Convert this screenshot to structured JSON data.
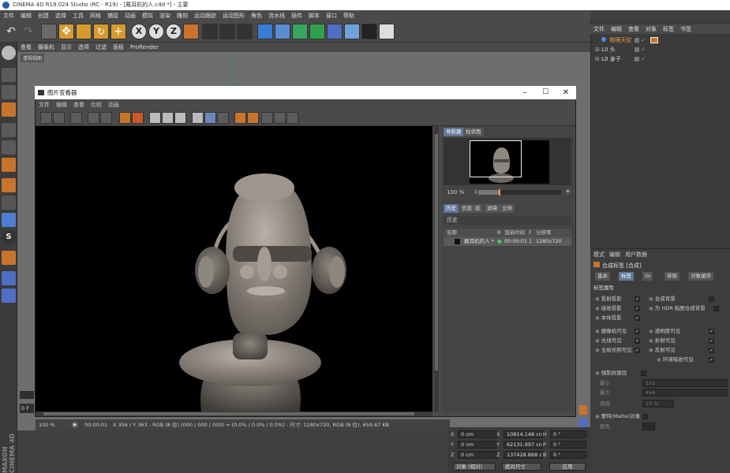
{
  "window": {
    "title": "CINEMA 4D R19.024 Studio (RC - R19) - [戴耳机的人.c4d *] - 主要"
  },
  "menubar": [
    "文件",
    "编辑",
    "创建",
    "选择",
    "工具",
    "网格",
    "捕捉",
    "动画",
    "模拟",
    "渲染",
    "雕刻",
    "运动跟踪",
    "运动图形",
    "角色",
    "流水线",
    "插件",
    "脚本",
    "窗口",
    "帮助"
  ],
  "viewport": {
    "menu": [
      "查看",
      "摄像机",
      "显示",
      "选项",
      "过滤",
      "面板",
      "ProRender"
    ],
    "label": "透视视图"
  },
  "picture_viewer": {
    "title": "图片查看器",
    "menu": [
      "文件",
      "编辑",
      "查看",
      "比较",
      "动画"
    ],
    "side_tabs": [
      "导航器",
      "柱状图"
    ],
    "zoom": "100 %",
    "history_tabs": [
      "历史",
      "信息",
      "层",
      "滤镜",
      "立体"
    ],
    "history_label": "历史",
    "table_headers": [
      "名称",
      "R",
      "渲染时间",
      "F",
      "分辨率"
    ],
    "table_row": {
      "name": "戴耳机的人 *",
      "r": "●",
      "time": "00:00:01",
      "f": "1",
      "res": "1280x720"
    },
    "status": {
      "zoom": "100 %",
      "time": "00:00:01",
      "info": "X 356 / Y 363 - RGB (8 位) (000 / 000 / 000) = (0.0% / 0.0% / 0.0%) - 尺寸: 1280x720, RGB (8 位), 659.67 KB"
    }
  },
  "right_tabs": [
    "文件",
    "编辑",
    "查看",
    "对象",
    "标签",
    "书签"
  ],
  "objects": [
    {
      "name": "物理天空",
      "color": "#e8a33a"
    },
    {
      "name": "头",
      "color": "#ddd"
    },
    {
      "name": "身子",
      "color": "#ddd"
    }
  ],
  "attributes": {
    "menu": [
      "模式",
      "编辑",
      "用户数据"
    ],
    "object": "合成标签 [合成]",
    "tabs": [
      "基本",
      "标签",
      "GI",
      "排除",
      "对象缓存"
    ],
    "section": "标签属性",
    "left_checks": [
      "投射投影",
      "接收投影",
      "本体投影",
      "摄像机可见",
      "光线可见",
      "全局光照可见"
    ],
    "right_checks": [
      "合成背景",
      "为 HDR 贴图合成背景",
      "透明度可见",
      "折射可见",
      "反射可见",
      "环境吸收可见"
    ],
    "extra": [
      "强制抗锯齿",
      "最小",
      "最大",
      "阈值",
      "蒙特(Matte)对象",
      "颜色"
    ],
    "min_val": "1x1",
    "max_val": "4x4",
    "threshold": "10 %"
  },
  "coords": {
    "rows": [
      {
        "a": "X",
        "v1": "0 cm",
        "b": "X",
        "v2": "10814.148 cn",
        "c": "H",
        "v3": "0 °"
      },
      {
        "a": "Y",
        "v1": "0 cm",
        "b": "Y",
        "v2": "62131.997 cn",
        "c": "P",
        "v3": "0 °"
      },
      {
        "a": "Z",
        "v1": "0 cm",
        "b": "Z",
        "v2": "137428.868 c",
        "c": "B",
        "v3": "0 °"
      }
    ],
    "mode": "对象 (相对)",
    "size": "绝对尺寸",
    "apply": "应用"
  },
  "brand": "MAXON CINEMA 4D",
  "timeline": {
    "frame": "0 F"
  }
}
